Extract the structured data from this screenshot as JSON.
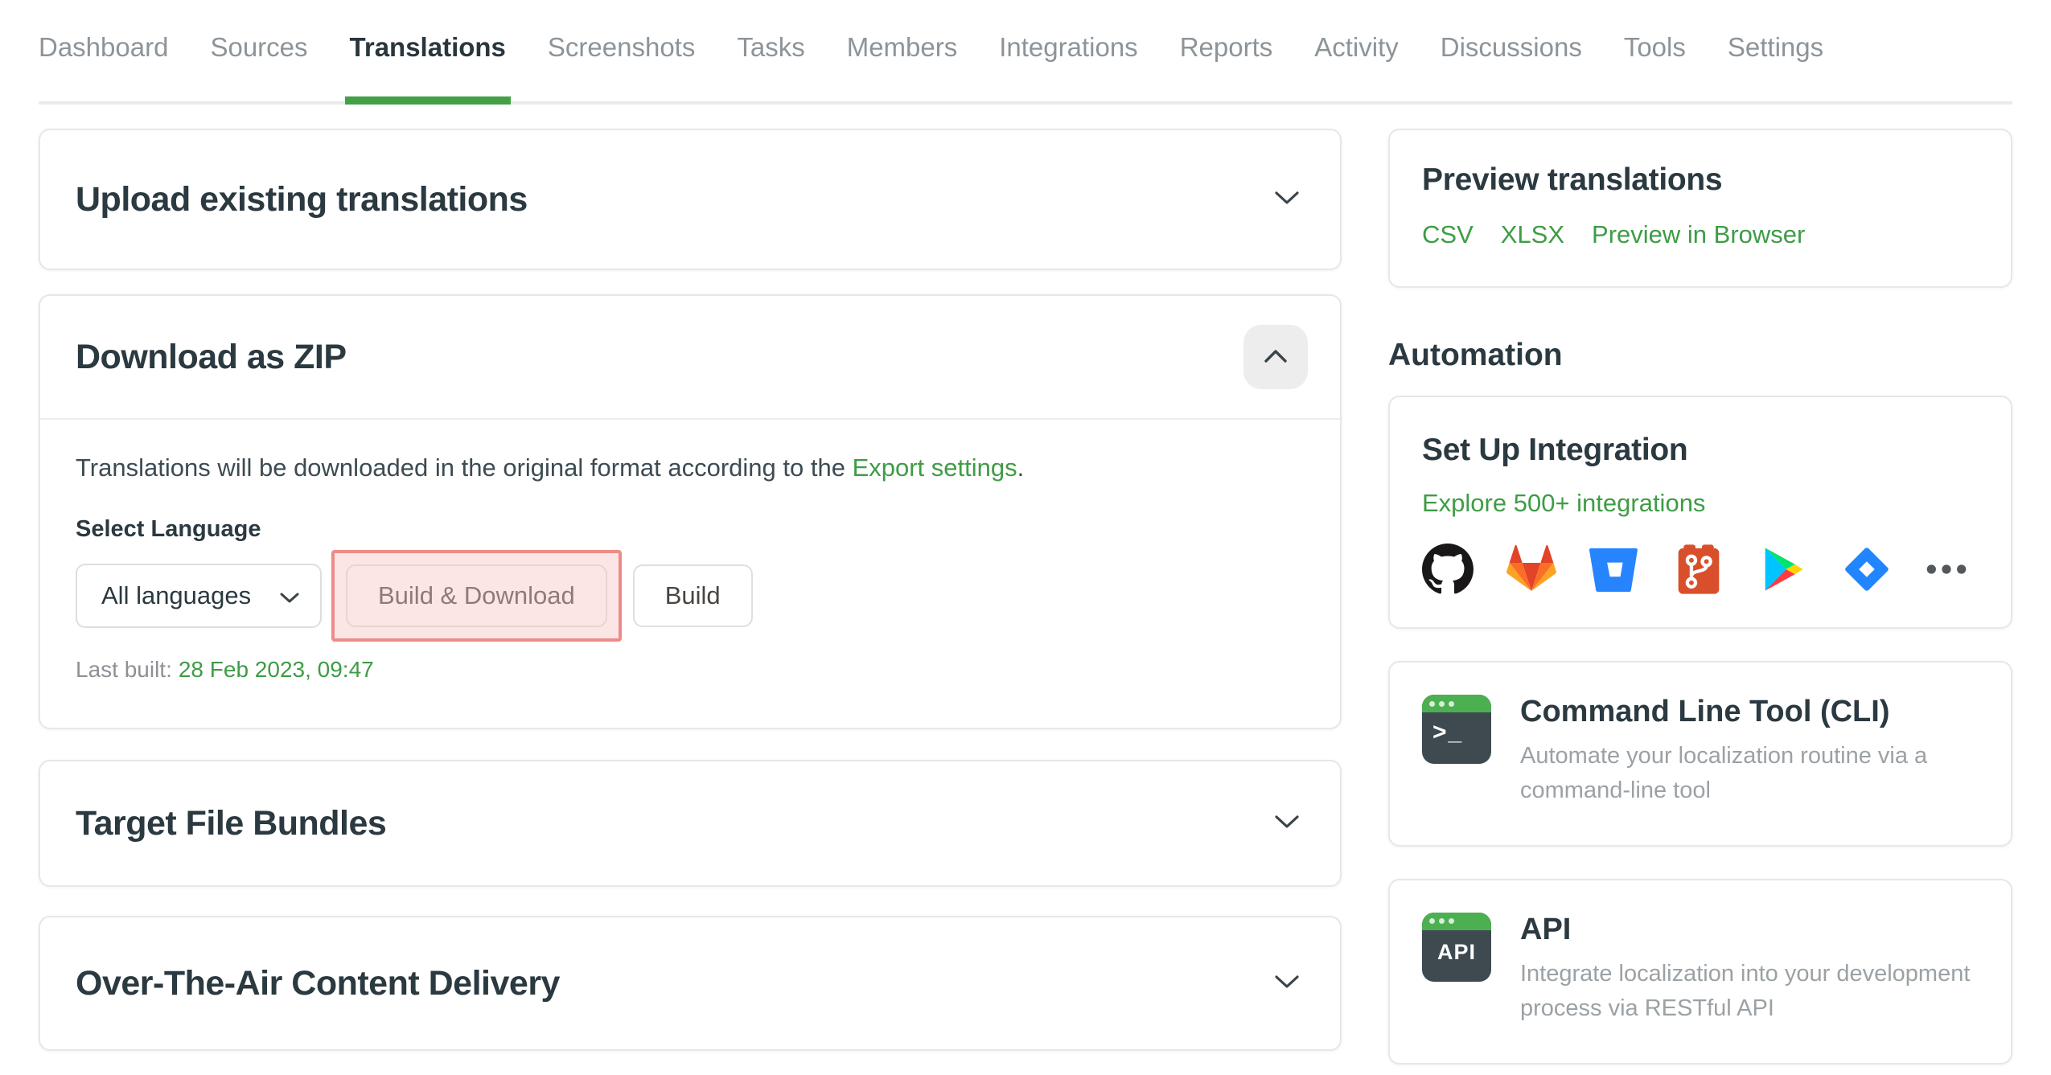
{
  "nav": {
    "items": [
      {
        "label": "Dashboard",
        "active": false
      },
      {
        "label": "Sources",
        "active": false
      },
      {
        "label": "Translations",
        "active": true
      },
      {
        "label": "Screenshots",
        "active": false
      },
      {
        "label": "Tasks",
        "active": false
      },
      {
        "label": "Members",
        "active": false
      },
      {
        "label": "Integrations",
        "active": false
      },
      {
        "label": "Reports",
        "active": false
      },
      {
        "label": "Activity",
        "active": false
      },
      {
        "label": "Discussions",
        "active": false
      },
      {
        "label": "Tools",
        "active": false
      },
      {
        "label": "Settings",
        "active": false
      }
    ]
  },
  "panels": {
    "upload": {
      "title": "Upload existing translations"
    },
    "download": {
      "title": "Download as ZIP",
      "description_prefix": "Translations will be downloaded in the original format according to the ",
      "description_link": "Export settings",
      "description_suffix": ".",
      "select_label": "Select Language",
      "language_value": "All languages",
      "build_download_label": "Build & Download",
      "build_label": "Build",
      "last_built_label": "Last built:",
      "last_built_value": "28 Feb 2023, 09:47"
    },
    "bundles": {
      "title": "Target File Bundles"
    },
    "ota": {
      "title": "Over-The-Air Content Delivery"
    }
  },
  "sidebar": {
    "preview": {
      "title": "Preview translations",
      "links": [
        "CSV",
        "XLSX",
        "Preview in Browser"
      ]
    },
    "automation_heading": "Automation",
    "integration": {
      "title": "Set Up Integration",
      "link": "Explore 500+ integrations",
      "icons": [
        "github",
        "gitlab",
        "bitbucket",
        "git",
        "google-play",
        "jira",
        "more"
      ]
    },
    "cli": {
      "title": "Command Line Tool (CLI)",
      "icon_text": ">_",
      "description": "Automate your localization routine via a command-line tool"
    },
    "api": {
      "title": "API",
      "icon_text": "API",
      "description": "Integrate localization into your development process via RESTful API"
    }
  },
  "colors": {
    "accent_green": "#43a047",
    "link_green": "#3e9c46",
    "highlight_border": "#ec8c88",
    "highlight_fill": "#f6c4c0",
    "title_dark": "#2b3940",
    "nav_inactive": "#8d9499"
  }
}
